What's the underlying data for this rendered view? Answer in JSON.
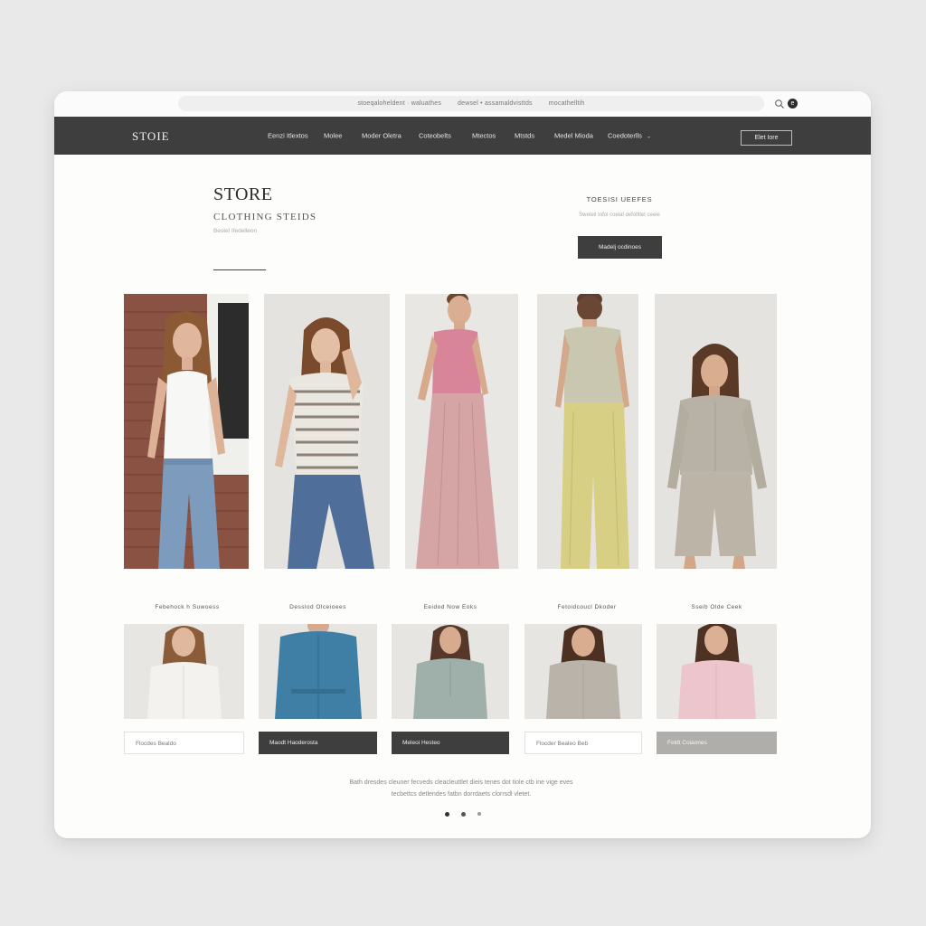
{
  "browser": {
    "url_segments": [
      "stoeqaloheldent · waluathes",
      "dewsel • assamaldvisttds",
      "mocathelltih"
    ],
    "user_initial": "e"
  },
  "nav": {
    "brand": "STOIE",
    "links": [
      "Eenzi Itlextos",
      "Molee",
      "Moder Oletra",
      "Coteobelts",
      "Mtectos",
      "Mtstds",
      "Medel Mioda",
      "Coedoterlls"
    ],
    "button": "Elet Iore"
  },
  "hero": {
    "title": "STORE",
    "subtitle": "CLOTHING STEIDS",
    "caption": "Bestel Ifedelleon",
    "promo_heading": "TOESISI UEEFES",
    "promo_text": "Sweteil tofol coelal defolltlet ceeie",
    "promo_button": "Madelj ocdinoes"
  },
  "categories": [
    {
      "label": "Febehock h Suwoess",
      "button": "Flocdes Bealdo",
      "style": "light"
    },
    {
      "label": "Desslod Olceioees",
      "button": "Maodt Haoderosta",
      "style": "dark"
    },
    {
      "label": "Eeidod Now Eoks",
      "button": "Meleoi Hesteo",
      "style": "dark"
    },
    {
      "label": "Fetoidcoucl Dkoder",
      "button": "Flocder Bealeo Beb",
      "style": "light"
    },
    {
      "label": "Sseib Olde Ceek",
      "button": "Feldt Coiaones",
      "style": "grey"
    }
  ],
  "footer": {
    "line1": "Bath dresdes cleuner fecveds cleacleuttlet dieis tenes dot tiole ctb ine vige eves",
    "line2": "tecbettcs detlendes fatbn dorrdaets clorrsdl vletet."
  },
  "carousel": {
    "dots": 3,
    "active": 0
  },
  "colors": {
    "nav_bg": "#3e3e3e",
    "accent_dark": "#3e3e3e",
    "page_bg": "#e9e9e9"
  }
}
